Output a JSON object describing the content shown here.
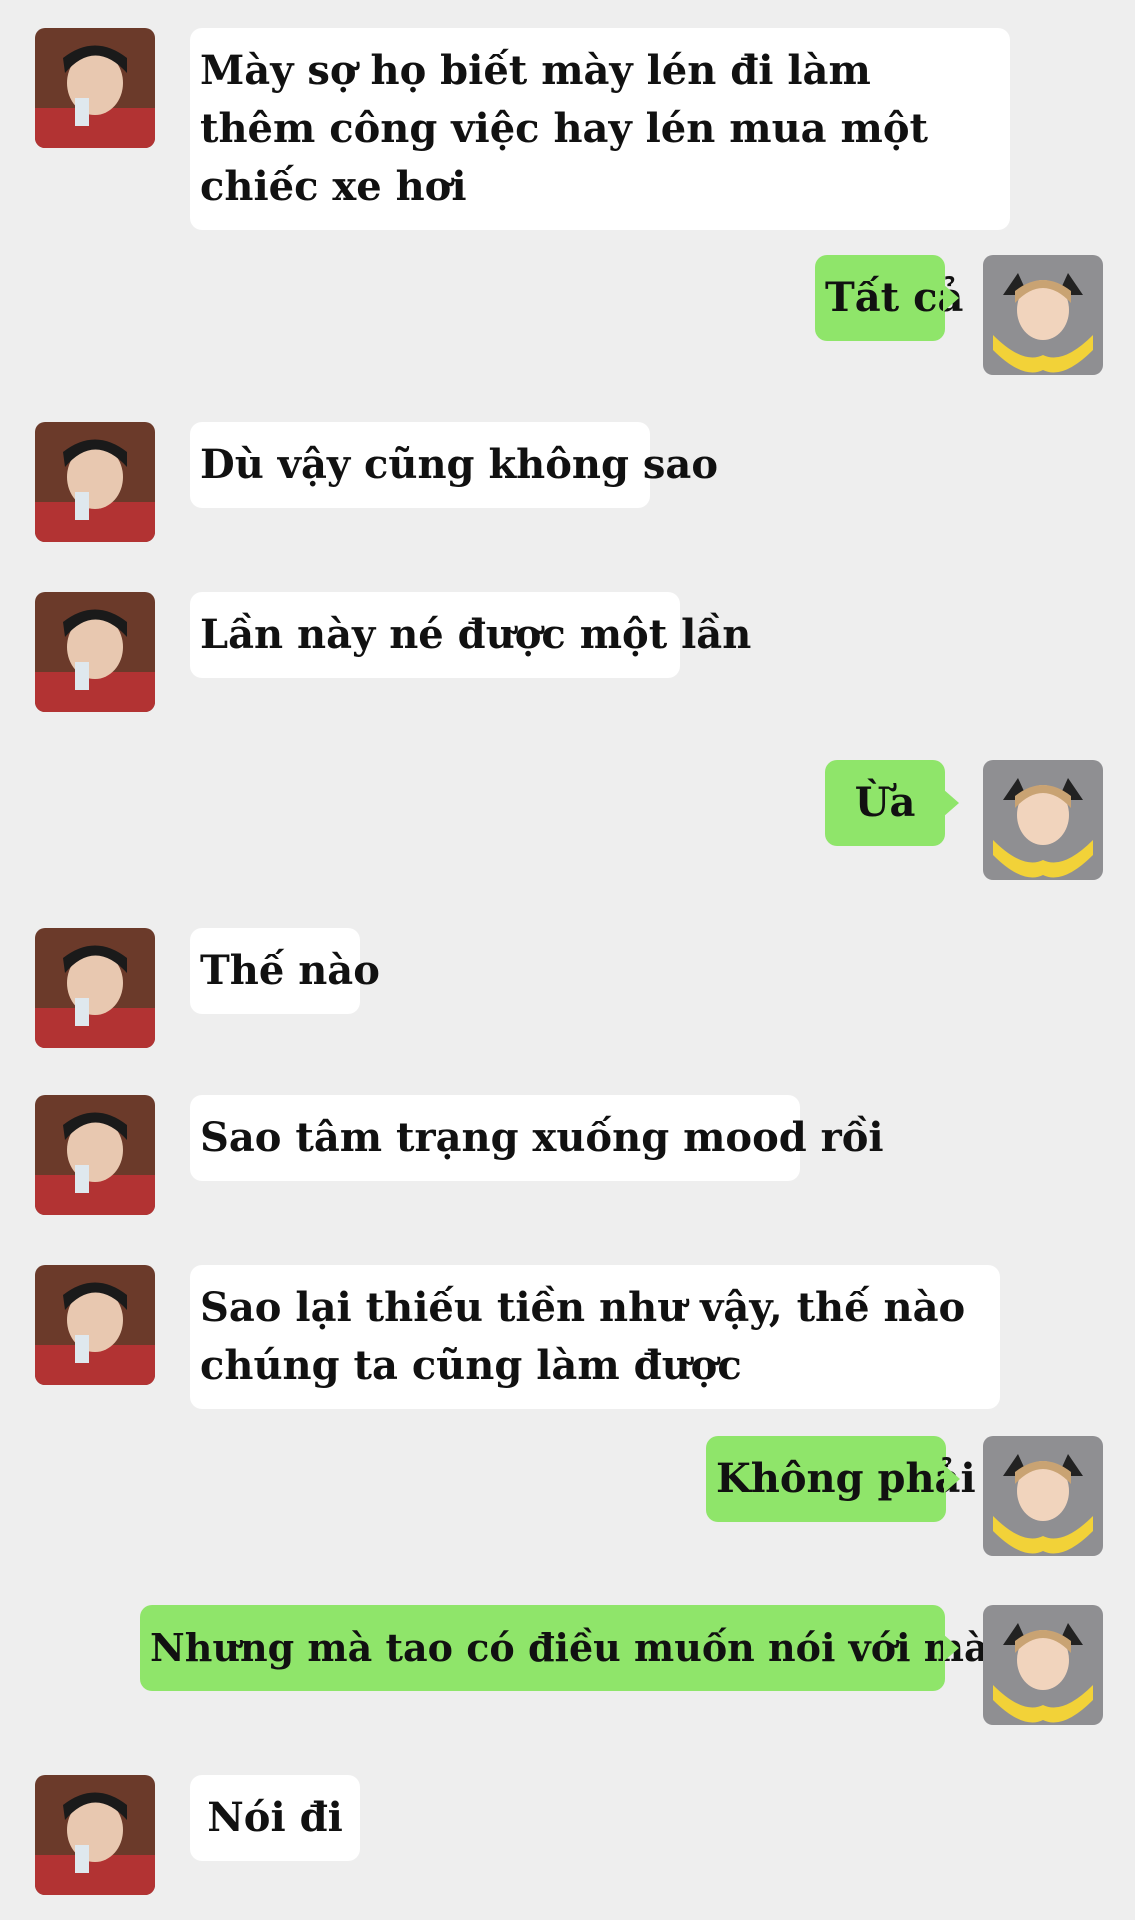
{
  "messages": [
    {
      "side": "left",
      "text": "Mày sợ họ biết mày lén đi làm thêm công việc hay lén mua một chiếc xe hơi"
    },
    {
      "side": "right",
      "text": "Tất cả"
    },
    {
      "side": "left",
      "text": "Dù vậy cũng không sao"
    },
    {
      "side": "left",
      "text": "Lần này né được một lần"
    },
    {
      "side": "right",
      "text": "Ừa"
    },
    {
      "side": "left",
      "text": "Thế nào"
    },
    {
      "side": "left",
      "text": "Sao tâm trạng xuống mood rồi"
    },
    {
      "side": "left",
      "text": "Sao lại thiếu tiền như vậy, thế nào chúng ta cũng làm được"
    },
    {
      "side": "right",
      "text": "Không phải"
    },
    {
      "side": "right",
      "text": "Nhưng mà tao có điều muốn nói với mày"
    },
    {
      "side": "left",
      "text": "Nói đi"
    }
  ],
  "colors": {
    "background": "#eeeeee",
    "left_bubble": "#ffffff",
    "right_bubble": "#8fe56a"
  },
  "icons": {
    "left_avatar": "contact-avatar-dark-hair",
    "right_avatar": "user-avatar-blond-hair"
  }
}
